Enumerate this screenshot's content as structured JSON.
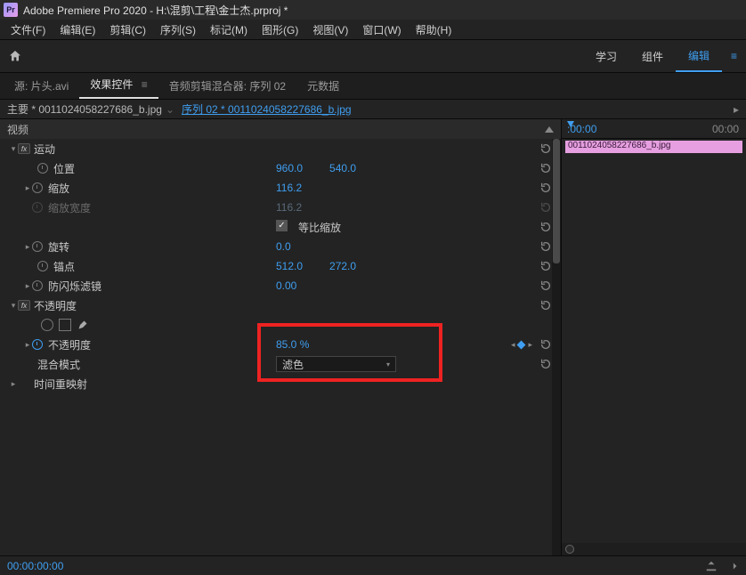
{
  "title": "Adobe Premiere Pro 2020 - H:\\混剪\\工程\\金士杰.prproj *",
  "app_icon_text": "Pr",
  "menu": [
    "文件(F)",
    "编辑(E)",
    "剪辑(C)",
    "序列(S)",
    "标记(M)",
    "图形(G)",
    "视图(V)",
    "窗口(W)",
    "帮助(H)"
  ],
  "workspace": {
    "tabs": [
      "学习",
      "组件",
      "编辑"
    ],
    "active": 2
  },
  "panel_tabs": {
    "items": [
      "源: 片头.avi",
      "效果控件",
      "音频剪辑混合器: 序列 02",
      "元数据"
    ],
    "active": 1,
    "badge": "≡"
  },
  "crumb": {
    "master": "主要 * 0011024058227686_b.jpg",
    "seq": "序列 02 * 0011024058227686_b.jpg"
  },
  "section_header": "视频",
  "motion": {
    "label": "运动",
    "position": {
      "label": "位置",
      "x": "960.0",
      "y": "540.0"
    },
    "scale": {
      "label": "缩放",
      "v": "116.2"
    },
    "scale_w": {
      "label": "缩放宽度",
      "v": "116.2"
    },
    "uniform": {
      "label": "等比缩放",
      "checked": true
    },
    "rotation": {
      "label": "旋转",
      "v": "0.0"
    },
    "anchor": {
      "label": "锚点",
      "x": "512.0",
      "y": "272.0"
    },
    "flicker": {
      "label": "防闪烁滤镜",
      "v": "0.00"
    }
  },
  "opacity": {
    "label": "不透明度",
    "value_label": "不透明度",
    "value": "85.0 %",
    "blend_label": "混合模式",
    "blend_value": "滤色"
  },
  "time_remap": {
    "label": "时间重映射"
  },
  "timeline": {
    "tc_start": ":00:00",
    "tc_end": "00:00",
    "clip_name": "0011024058227686_b.jpg"
  },
  "footer_tc": "00:00:00:00"
}
